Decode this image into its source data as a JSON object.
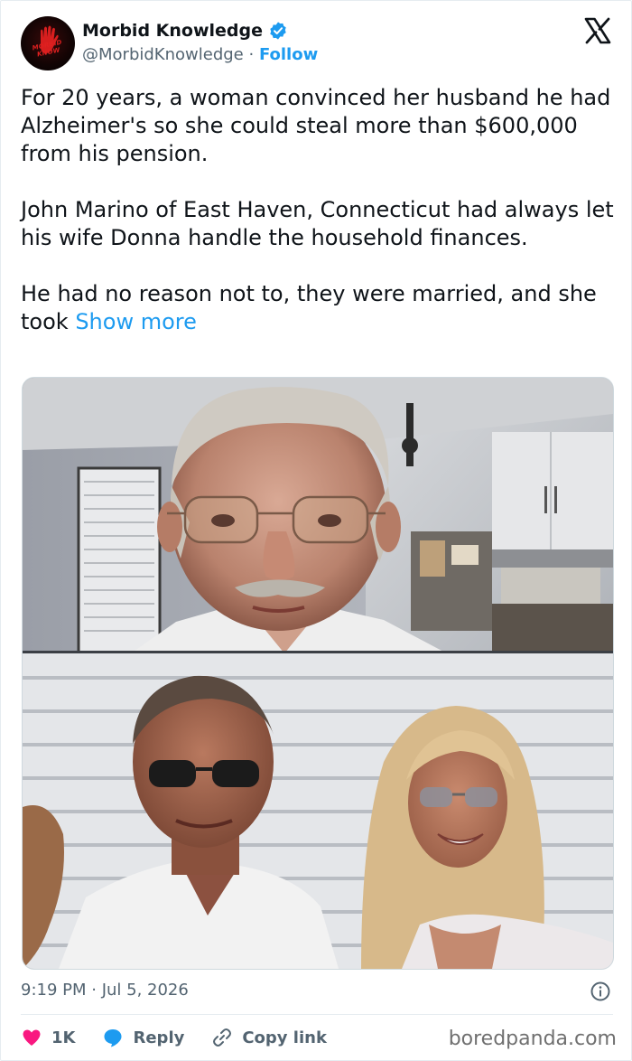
{
  "header": {
    "display_name": "Morbid Knowledge",
    "handle": "@MorbidKnowledge",
    "separator": "·",
    "follow_label": "Follow",
    "avatar_text": "MORBID KNOW"
  },
  "tweet": {
    "paragraphs": [
      "For 20 years, a woman convinced her husband he had Alzheimer's so she could steal more than $600,000 from his pension.",
      "John Marino of East Haven, Connecticut had always let his wife Donna handle the household finances."
    ],
    "last_paragraph": "He had no reason not to, they were married, and she took ",
    "show_more_label": "Show more"
  },
  "footer": {
    "timestamp": "9:19 PM · Jul 5, 2026",
    "like_count": "1K",
    "reply_label": "Reply",
    "copy_link_label": "Copy link"
  },
  "watermark": "boredpanda.com",
  "colors": {
    "accent": "#1d9bf0",
    "like": "#f91880",
    "text": "#0f1419",
    "muted": "#536471"
  },
  "icons": [
    "verified-badge-icon",
    "x-logo-icon",
    "info-icon",
    "heart-icon",
    "reply-bubble-icon",
    "link-icon"
  ]
}
